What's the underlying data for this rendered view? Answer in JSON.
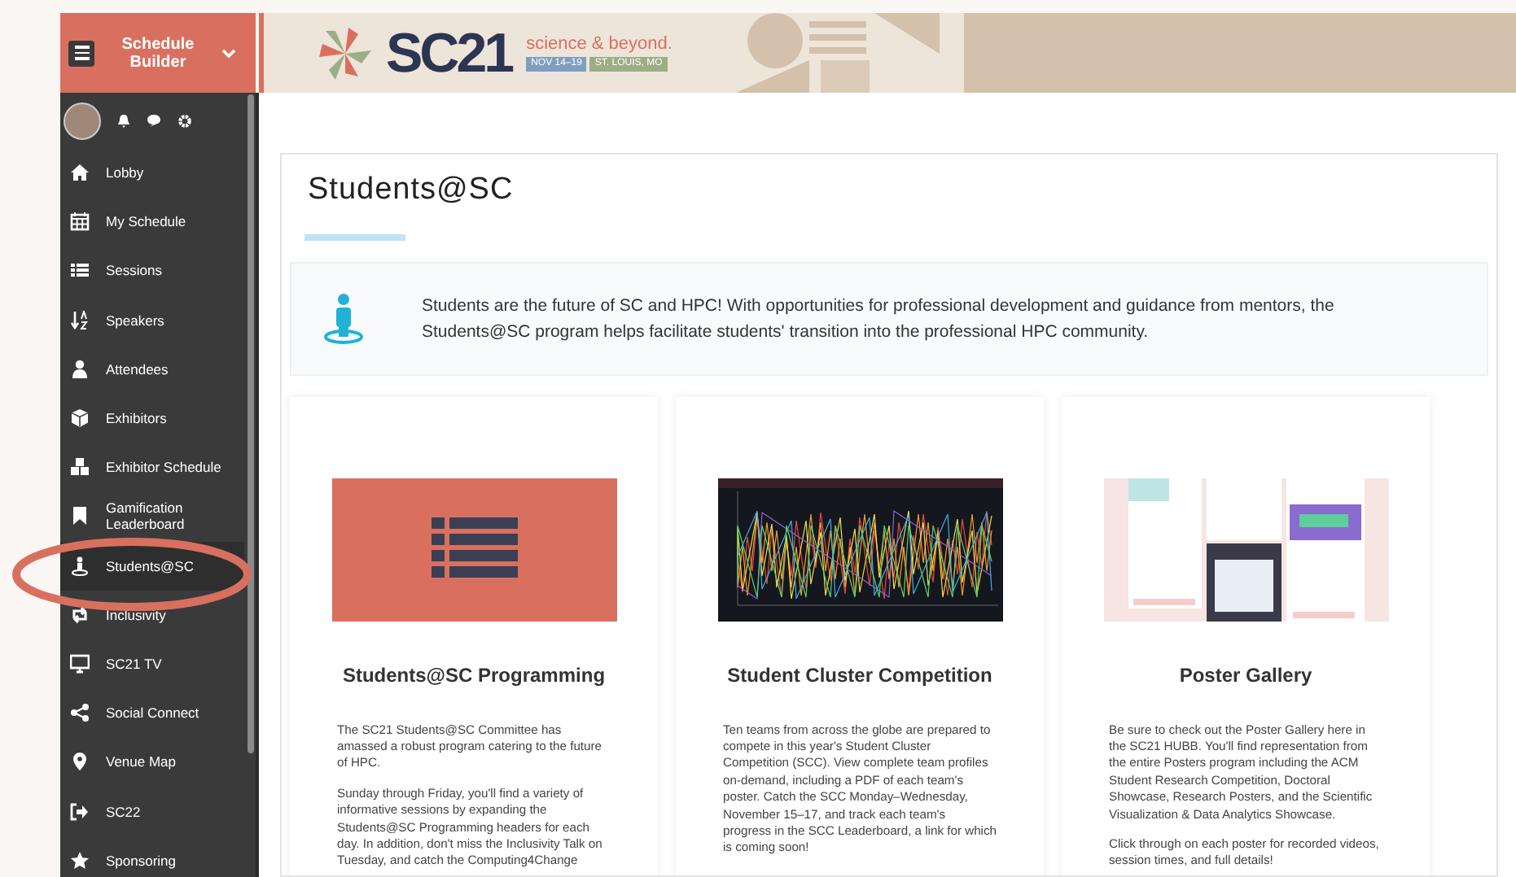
{
  "sidebar": {
    "title": "Schedule Builder",
    "items": [
      {
        "label": "Lobby",
        "selected": false
      },
      {
        "label": "My Schedule",
        "selected": false
      },
      {
        "label": "Sessions",
        "selected": false
      },
      {
        "label": "Speakers",
        "selected": false
      },
      {
        "label": "Attendees",
        "selected": false
      },
      {
        "label": "Exhibitors",
        "selected": false
      },
      {
        "label": "Exhibitor Schedule",
        "selected": false
      },
      {
        "label": "Gamification Leaderboard",
        "selected": false
      },
      {
        "label": "Students@SC",
        "selected": true
      },
      {
        "label": "Inclusivity",
        "selected": false
      },
      {
        "label": "SC21 TV",
        "selected": false
      },
      {
        "label": "Social Connect",
        "selected": false
      },
      {
        "label": "Venue Map",
        "selected": false
      },
      {
        "label": "SC22",
        "selected": false
      },
      {
        "label": "Sponsoring",
        "selected": false
      }
    ]
  },
  "banner": {
    "logo": "SC21",
    "tagline": "science & beyond.",
    "dates": "NOV 14–19",
    "place": "ST. LOUIS, MO"
  },
  "page": {
    "title": "Students@SC",
    "intro": "Students are the future of SC and HPC! With opportunities for professional development and guidance from mentors, the Students@SC program helps facilitate students' transition into the professional HPC community.",
    "cards": [
      {
        "kind": "icon",
        "title": "Students@SC Programming",
        "paragraphs": [
          "The SC21 Students@SC Committee has amassed a robust program catering to the future of HPC.",
          "Sunday through Friday, you'll find a variety of informative sessions by expanding the Students@SC Programming headers for each day. In addition, don't miss the Inclusivity Talk on Tuesday, and catch the Computing4Change"
        ]
      },
      {
        "kind": "chart",
        "title": "Student Cluster Competition",
        "paragraphs": [
          "Ten teams from across the globe are prepared to compete in this year's Student Cluster Competition (SCC). View complete team profiles on-demand, including a PDF of each team's poster. Catch the SCC Monday–Wednesday, November 15–17, and track each team's progress in the SCC Leaderboard, a link for which is coming soon!"
        ]
      },
      {
        "kind": "posters",
        "title": "Poster Gallery",
        "paragraphs": [
          "Be sure to check out the Poster Gallery here in the SC21 HUBB. You'll find representation from the entire Posters program including the ACM Student Research Competition, Doctoral Showcase, Research Posters, and the Scientific Visualization & Data Analytics Showcase.",
          "Click through on each poster for recorded videos, session times, and full details!"
        ]
      }
    ]
  }
}
